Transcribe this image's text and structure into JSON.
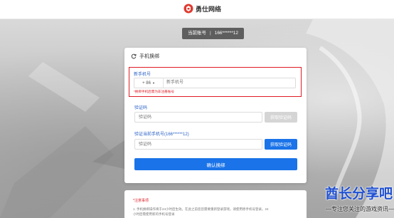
{
  "header": {
    "brand": "勇仕网络"
  },
  "account_chip": {
    "label": "当前账号",
    "divider": "|",
    "phone": "166******12"
  },
  "card": {
    "title": "手机换绑",
    "new_phone": {
      "label": "新手机号",
      "country_code": "+ 86",
      "placeholder": "新手机号",
      "hint": "*换绑手机后需为非注册账号"
    },
    "code": {
      "label": "验证码",
      "placeholder": "验证码",
      "button": "获取验证码"
    },
    "verify_current": {
      "label": "验证当前手机号(166******12)",
      "placeholder": "验证码",
      "button": "获取验证码"
    },
    "submit": "确认换绑"
  },
  "notice": {
    "title": "*注意事项",
    "lines": [
      "1. 手机换绑操作将于24小时后生效。在此之前您您需要重新登录游戏，请使用原手机号登录。24",
      "小时后需使用新的手机号登录"
    ]
  },
  "watermark": {
    "main": "酋长分享吧",
    "sub": "—专注您关注的游戏资讯—"
  },
  "colors": {
    "accent_blue": "#1a73e8",
    "highlight_red": "#e01a24",
    "label_blue": "#2b62c7"
  }
}
